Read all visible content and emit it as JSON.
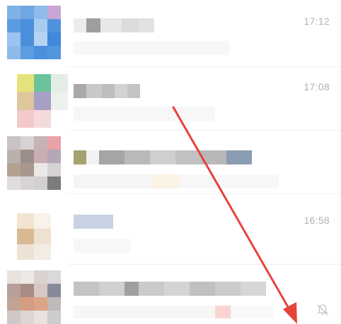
{
  "chat_list": {
    "items": [
      {
        "time": "17:12",
        "muted": false
      },
      {
        "time": "17:08",
        "muted": false
      },
      {
        "time": "",
        "muted": false
      },
      {
        "time": "16:58",
        "muted": false
      },
      {
        "time": "",
        "muted": true
      }
    ]
  },
  "icons": {
    "mute": "bell-slash-icon",
    "annotation": "red-arrow"
  },
  "colors": {
    "time_text": "#b2b2b2",
    "annotation_arrow": "#e8433b",
    "divider": "#f0f0f0"
  }
}
